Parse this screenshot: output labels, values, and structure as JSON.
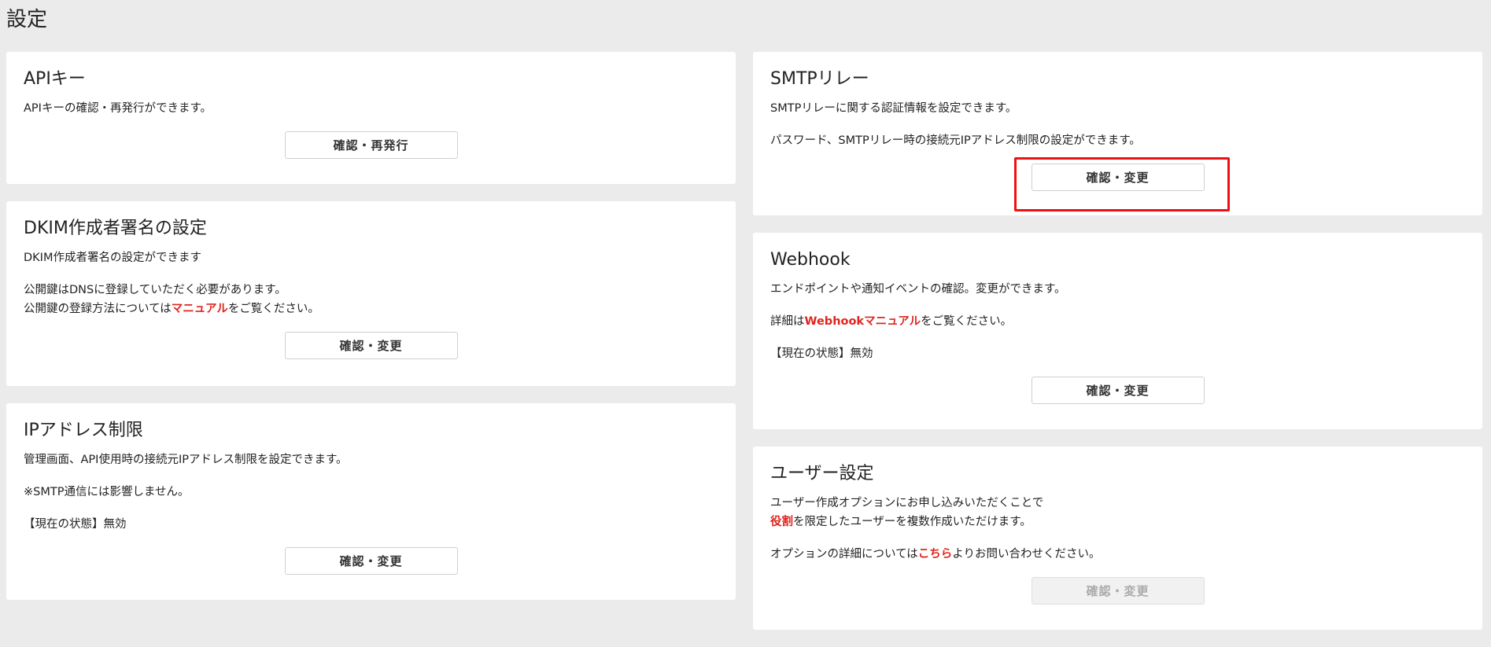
{
  "page": {
    "title": "設定"
  },
  "cards": {
    "api_key": {
      "title": "APIキー",
      "desc": "APIキーの確認・再発行ができます。",
      "button": "確認・再発行"
    },
    "dkim": {
      "title": "DKIM作成者署名の設定",
      "desc1": "DKIM作成者署名の設定ができます",
      "desc2": "公開鍵はDNSに登録していただく必要があります。",
      "desc3_pre": "公開鍵の登録方法については",
      "desc3_link": "マニュアル",
      "desc3_post": "をご覧ください。",
      "button": "確認・変更"
    },
    "ip": {
      "title": "IPアドレス制限",
      "desc1": "管理画面、API使用時の接続元IPアドレス制限を設定できます。",
      "desc2": "※SMTP通信には影響しません。",
      "status": "【現在の状態】無効",
      "button": "確認・変更"
    },
    "smtp": {
      "title": "SMTPリレー",
      "desc1": "SMTPリレーに関する認証情報を設定できます。",
      "desc2": "パスワード、SMTPリレー時の接続元IPアドレス制限の設定ができます。",
      "button": "確認・変更",
      "highlight_color": "#ee1111"
    },
    "webhook": {
      "title": "Webhook",
      "desc1": "エンドポイントや通知イベントの確認。変更ができます。",
      "desc2_pre": "詳細は",
      "desc2_link": "Webhookマニュアル",
      "desc2_post": "をご覧ください。",
      "status": "【現在の状態】無効",
      "button": "確認・変更"
    },
    "user": {
      "title": "ユーザー設定",
      "desc1": "ユーザー作成オプションにお申し込みいただくことで",
      "desc2_link": "役割",
      "desc2_post": "を限定したユーザーを複数作成いただけます。",
      "desc3_pre": "オプションの詳細については",
      "desc3_link": "こちら",
      "desc3_post": "よりお問い合わせください。",
      "button": "確認・変更",
      "button_disabled": true
    }
  },
  "colors": {
    "link": "#e0241d",
    "background": "#ebebeb",
    "card": "#ffffff"
  }
}
